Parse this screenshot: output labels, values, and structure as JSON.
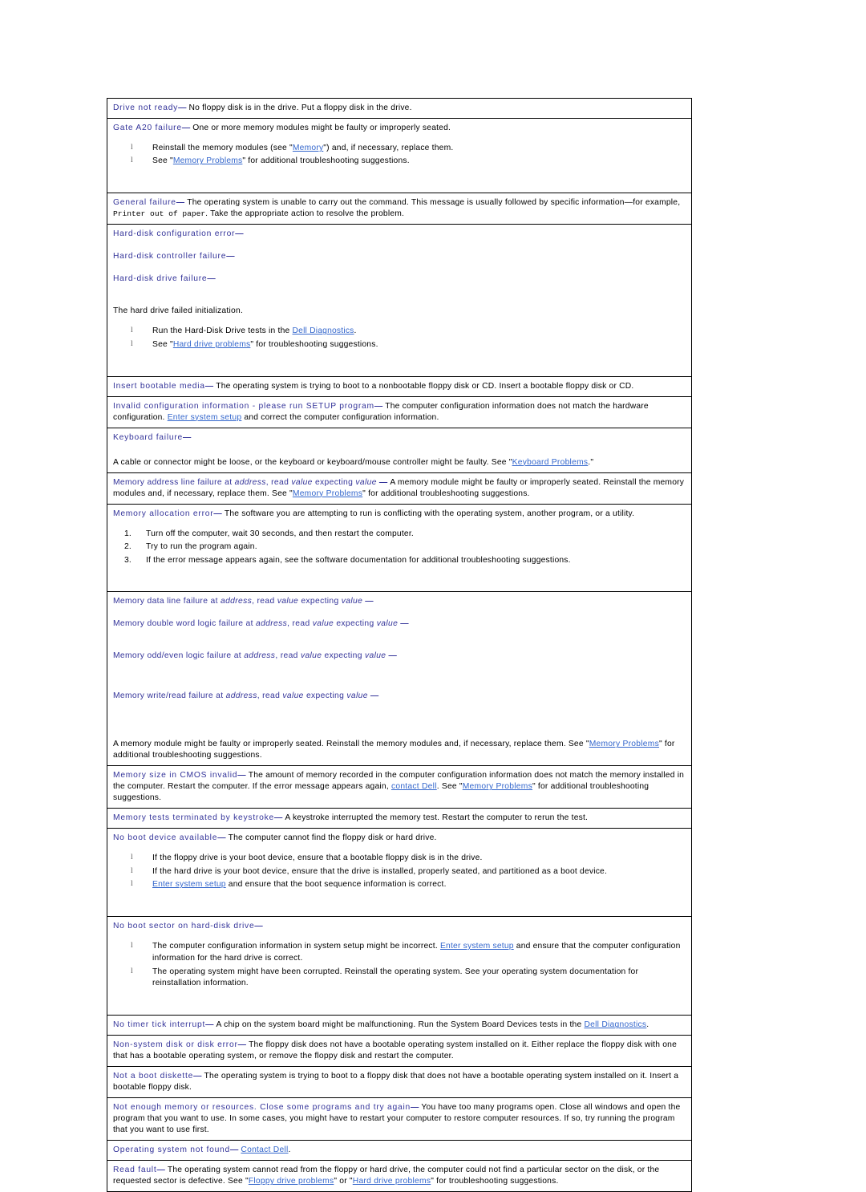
{
  "document": {
    "kind": "dell-system-messages-table",
    "bullet_glyph": "l",
    "colors": {
      "heading": "#333399",
      "link": "#3366cc",
      "body": "#000000",
      "border": "#000000",
      "background": "#ffffff"
    }
  },
  "rows": [
    {
      "id": "drive-not-ready",
      "heading": "Drive not ready",
      "dash": "—",
      "body": "No floppy disk is in the drive. Put a floppy disk in the drive."
    },
    {
      "id": "gate-a20-failure",
      "heading": "Gate A20 failure",
      "dash": "—",
      "body": "One or more memory modules might be faulty or improperly seated.",
      "bullets": [
        {
          "pre": "Reinstall the memory modules (see \"",
          "link": "Memory",
          "post": "\") and, if necessary, replace them."
        },
        {
          "pre": "See \"",
          "link": "Memory Problems",
          "post": "\" for additional troubleshooting suggestions."
        }
      ]
    },
    {
      "id": "general-failure",
      "heading": "General failure",
      "dash": "—",
      "body_part1": "The operating system is unable to carry out the command. This message is usually followed by specific information—for example, ",
      "mono": "Printer out of paper",
      "body_part2": ". Take the appropriate action to resolve the problem."
    },
    {
      "id": "hard-disk-group",
      "headings": [
        {
          "text": "Hard-disk configuration error",
          "dash": "—"
        },
        {
          "text": "Hard-disk controller failure",
          "dash": "—"
        },
        {
          "text": "Hard-disk drive failure",
          "dash": "—"
        }
      ],
      "body": "The hard drive failed initialization.",
      "bullets": [
        {
          "pre": "Run the Hard-Disk Drive tests in the ",
          "link": "Dell Diagnostics",
          "post": "."
        },
        {
          "pre": "See \"",
          "link": "Hard drive problems",
          "post": "\" for troubleshooting suggestions."
        }
      ]
    },
    {
      "id": "insert-bootable-media",
      "heading": "Insert bootable media",
      "dash": "—",
      "body": "The operating system is trying to boot to a nonbootable floppy disk or CD. Insert a bootable floppy disk or CD."
    },
    {
      "id": "invalid-configuration-information",
      "heading": "Invalid configuration information - please run SETUP program",
      "dash": "—",
      "body_part1": "The computer configuration information does not match the hardware configuration. ",
      "link": "Enter system setup",
      "body_part2": " and correct the computer configuration information."
    },
    {
      "id": "keyboard-failure",
      "heading": "Keyboard failure",
      "dash": "—",
      "body_part1": " A cable or connector might be loose, or the keyboard or keyboard/mouse controller might be faulty. See \"",
      "link": "Keyboard Problems",
      "body_part2": ".\""
    },
    {
      "id": "memory-address-line-failure",
      "heading_pre": "Memory address line failure at ",
      "heading_italic1": "address",
      "heading_mid1": ", read ",
      "heading_italic2": "value",
      "heading_mid2": " expecting ",
      "heading_italic3": "value",
      "dash": "—",
      "body_part1": "A memory module might be faulty or improperly seated. Reinstall the memory modules and, if necessary, replace them. See \"",
      "link": "Memory Problems",
      "body_part2": "\" for additional troubleshooting suggestions."
    },
    {
      "id": "memory-allocation-error",
      "heading": "Memory allocation error",
      "dash": "—",
      "body": "The software you are attempting to run is conflicting with the operating system, another program, or a utility.",
      "numbered": [
        "Turn off the computer, wait 30 seconds, and then restart the computer.",
        "Try to run the program again.",
        "If the error message appears again, see the software documentation for additional troubleshooting suggestions."
      ]
    },
    {
      "id": "memory-failure-group",
      "headings": [
        {
          "pre": "Memory data line failure at ",
          "italic1": "address",
          "mid1": ", read ",
          "italic2": "value",
          "mid2": " expecting ",
          "italic3": "value",
          "dash": "—"
        },
        {
          "pre": "Memory double word logic failure at ",
          "italic1": "address",
          "mid1": ", read ",
          "italic2": "value",
          "mid2": " expecting ",
          "italic3": "value",
          "dash": "—"
        },
        {
          "pre": "Memory odd/even logic failure at ",
          "italic1": "address",
          "mid1": ", read ",
          "italic2": "value",
          "mid2": " expecting ",
          "italic3": "value",
          "dash": "—"
        },
        {
          "pre": "Memory write/read failure at ",
          "italic1": "address",
          "mid1": ", read ",
          "italic2": "value",
          "mid2": " expecting ",
          "italic3": "value",
          "dash": "—"
        }
      ],
      "body_part1": "A memory module might be faulty or improperly seated. Reinstall the memory modules and, if necessary, replace them. See \"",
      "link": "Memory Problems",
      "body_part2": "\" for additional troubleshooting suggestions."
    },
    {
      "id": "memory-size-in-cmos-invalid",
      "heading": "Memory size in CMOS invalid",
      "dash": "—",
      "body_part1": "The amount of memory recorded in the computer configuration information does not match the memory installed in the computer. Restart the computer. If the error message appears again, ",
      "link1": "contact Dell",
      "body_part2": ". See \"",
      "link2": "Memory Problems",
      "body_part3": "\" for additional troubleshooting suggestions."
    },
    {
      "id": "memory-tests-terminated-by-keystroke",
      "heading": "Memory tests terminated by keystroke",
      "dash": "—",
      "body": "A keystroke interrupted the memory test. Restart the computer to rerun the test."
    },
    {
      "id": "no-boot-device-available",
      "heading": "No boot device available",
      "dash": "—",
      "body": "The computer cannot find the floppy disk or hard drive.",
      "bullets": [
        {
          "pre": "If the floppy drive is your boot device, ensure that a bootable floppy disk is in the drive.",
          "link": "",
          "post": ""
        },
        {
          "pre": "If the hard drive is your boot device, ensure that the drive is installed, properly seated, and partitioned as a boot device.",
          "link": "",
          "post": ""
        },
        {
          "pre": "",
          "link": "Enter system setup",
          "post": " and ensure that the boot sequence information is correct."
        }
      ]
    },
    {
      "id": "no-boot-sector-on-hard-disk-drive",
      "heading": "No boot sector on hard-disk drive",
      "dash": "—",
      "bullets": [
        {
          "pre": "The computer configuration information in system setup might be incorrect. ",
          "link": "Enter system setup",
          "post": " and ensure that the computer configuration information for the hard drive is correct."
        },
        {
          "pre": "The operating system might have been corrupted. Reinstall the operating system. See your operating system documentation for reinstallation information.",
          "link": "",
          "post": ""
        }
      ]
    },
    {
      "id": "no-timer-tick-interrupt",
      "heading": "No timer tick interrupt",
      "dash": "—",
      "body_part1": "A chip on the system board might be malfunctioning. Run the System Board Devices tests in the ",
      "link": "Dell Diagnostics",
      "body_part2": "."
    },
    {
      "id": "non-system-disk-or-disk-error",
      "heading": "Non-system disk or disk error",
      "dash": "—",
      "body": "The floppy disk does not have a bootable operating system installed on it. Either replace the floppy disk with one that has a bootable operating system, or remove the floppy disk and restart the computer."
    },
    {
      "id": "not-a-boot-diskette",
      "heading": "Not a boot diskette",
      "dash": "—",
      "body": "The operating system is trying to boot to a floppy disk that does not have a bootable operating system installed on it. Insert a bootable floppy disk."
    },
    {
      "id": "not-enough-memory-or-resources",
      "heading": "Not enough memory or resources. Close some programs and try again",
      "dash": "—",
      "body": "You have too many programs open. Close all windows and open the program that you want to use. In some cases, you might have to restart your computer to restore computer resources. If so, try running the program that you want to use first."
    },
    {
      "id": "operating-system-not-found",
      "heading": "Operating system not found",
      "dash": "—",
      "link": "Contact Dell",
      "body_part2": "."
    },
    {
      "id": "read-fault",
      "heading": "Read fault",
      "dash": "—",
      "body_part1": "The operating system cannot read from the floppy or hard drive, the computer could not find a particular sector on the disk, or the requested sector is defective. See \"",
      "link1": "Floppy drive problems",
      "body_part2": "\" or \"",
      "link2": "Hard drive problems",
      "body_part3": "\" for troubleshooting suggestions."
    }
  ]
}
